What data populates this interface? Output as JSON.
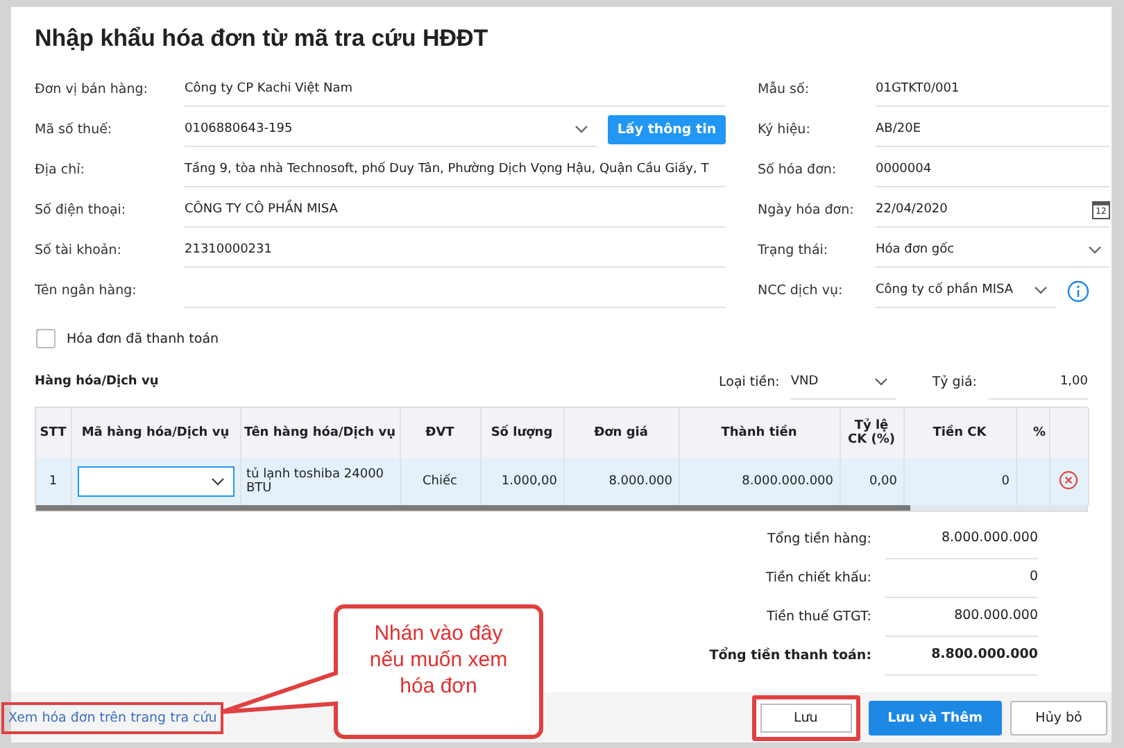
{
  "title": "Nhập khẩu hóa đơn từ mã tra cứu HĐĐT",
  "seller_fields": [
    {
      "label": "Đơn vị bán hàng:",
      "value": "Công ty CP Kachi Việt Nam",
      "kind": "text"
    },
    {
      "label": "Mã số thuế:",
      "value": "0106880643-195",
      "kind": "select",
      "button": "Lấy thông tin"
    },
    {
      "label": "Địa chỉ:",
      "value": "Tầng 9, tòa nhà Technosoft, phố Duy Tân, Phường Dịch Vọng Hậu, Quận Cầu Giấy, T",
      "kind": "text"
    },
    {
      "label": "Số điện thoại:",
      "value": "CÔNG TY CÔ PHẦN MISA",
      "kind": "text"
    },
    {
      "label": "Số tài khoản:",
      "value": "21310000231",
      "kind": "text"
    },
    {
      "label": "Tên ngân hàng:",
      "kind": "text"
    }
  ],
  "invoice_fields": [
    {
      "label": "Mẫu số:",
      "value": "01GTKT0/001",
      "kind": "text"
    },
    {
      "label": "Ký hiệu:",
      "value": "AB/20E",
      "kind": "text"
    },
    {
      "label": "Số hóa đơn:",
      "value": "0000004",
      "kind": "text"
    },
    {
      "label": "Ngày hóa đơn:",
      "value": "22/04/2020",
      "kind": "date",
      "day": "12"
    },
    {
      "label": "Trạng thái:",
      "value": "Hóa đơn gốc",
      "kind": "select"
    },
    {
      "label": "NCC dịch vụ:",
      "value": "Công ty cố phần MISA",
      "kind": "select_info"
    }
  ],
  "paid_checkbox": {
    "label": "Hóa đơn đã thanh toán",
    "checked": false
  },
  "goods": {
    "title": "Hàng hóa/Dịch vụ",
    "currency_label": "Loại tiền:",
    "currency": "VND",
    "rate_label": "Tỷ giá:",
    "rate": "1,00",
    "columns": [
      "STT",
      "Mã hàng hóa/Dịch vụ",
      "Tên hàng hóa/Dịch vụ",
      "ĐVT",
      "Số lượng",
      "Đơn giá",
      "Thành tiền",
      "Tỷ lệ CK (%)",
      "Tiền CK",
      "%"
    ],
    "rows": [
      {
        "selected": true,
        "cells": [
          "1",
          "",
          "tủ lạnh toshiba 24000 BTU",
          "Chiếc",
          "1.000,00",
          "8.000.000",
          "8.000.000.000",
          "0,00",
          "0"
        ]
      }
    ]
  },
  "totals": [
    {
      "label": "Tổng tiền hàng:",
      "value": "8.000.000.000",
      "bold": false
    },
    {
      "label": "Tiền chiết khấu:",
      "value": "0",
      "bold": false
    },
    {
      "label": "Tiền thuế GTGT:",
      "value": "800.000.000",
      "bold": false
    },
    {
      "label": "Tổng tiền thanh toán:",
      "value": "8.800.000.000",
      "bold": true
    }
  ],
  "link": {
    "text": "Xem hóa đơn trên trang tra cứu",
    "highlighted": true
  },
  "buttons": [
    {
      "label": "Lưu",
      "kind": "secondary",
      "highlighted": true
    },
    {
      "label": "Lưu và Thêm",
      "kind": "primary",
      "highlighted": false
    },
    {
      "label": "Hủy bỏ",
      "kind": "secondary",
      "highlighted": false
    }
  ],
  "callout": {
    "text": "Nhán vào đây nếu muốn xem hóa đơn"
  }
}
